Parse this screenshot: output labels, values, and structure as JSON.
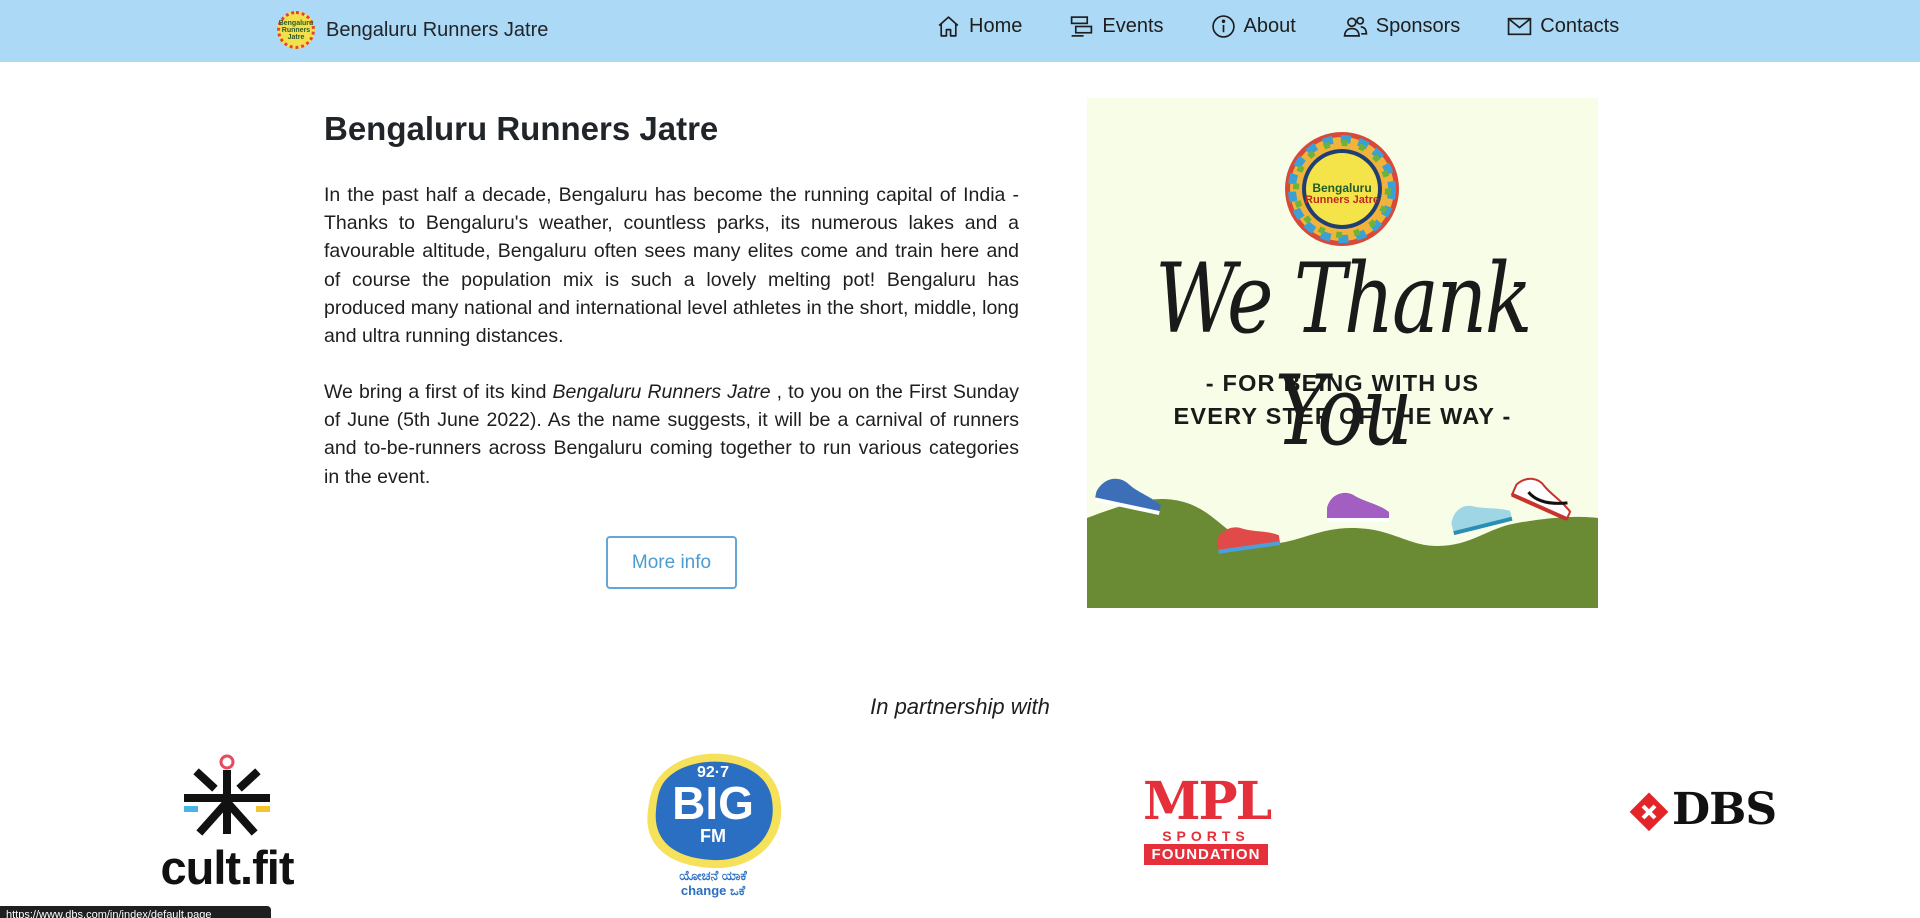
{
  "navbar": {
    "brand": "Bengaluru Runners Jatre",
    "brand_logo_lines": [
      "Bengaluru",
      "Runners Jatre"
    ],
    "links": [
      {
        "label": "Home",
        "icon": "home-icon"
      },
      {
        "label": "Events",
        "icon": "events-icon"
      },
      {
        "label": "About",
        "icon": "info-icon"
      },
      {
        "label": "Sponsors",
        "icon": "people-icon"
      },
      {
        "label": "Contacts",
        "icon": "envelope-icon"
      }
    ]
  },
  "main": {
    "title": "Bengaluru Runners Jatre",
    "paragraph1": "In the past half a decade, Bengaluru has become the running capital of India - Thanks to Bengaluru's weather, countless parks, its numerous lakes and a favourable altitude, Bengaluru often sees many elites come and train here and of course the population mix is such a lovely melting pot! Bengaluru has produced many national and international level athletes in the short, middle, long and ultra running distances.",
    "paragraph2_before": "We bring a first of its kind ",
    "paragraph2_emphasis": "Bengaluru Runners Jatre",
    "paragraph2_after": " , to you on the First Sunday of June (5th June 2022). As the name suggests, it will be a carnival of runners and to-be-runners across Bengaluru coming together to run various categories in the event.",
    "more_button": "More info"
  },
  "poster": {
    "logo_line1": "Bengaluru",
    "logo_line2": "Runners Jatre",
    "headline": "We Thank You",
    "line1": "- FOR BEING WITH US",
    "line2": "EVERY STEP OF THE WAY -",
    "colors": {
      "background": "#f8fde8",
      "hill": "#6a8a33"
    }
  },
  "partners": {
    "title": "In partnership with",
    "logos": [
      {
        "name": "cult.fit",
        "text": "cult.fit"
      },
      {
        "name": "92.7 BIG FM",
        "text_top": "92·7",
        "text_main": "BIG",
        "text_sub": "FM",
        "tagline_local": "ಯೋಚನೆ ಯಾಕೆ",
        "tagline": "change ಒಕೆ"
      },
      {
        "name": "MPL Sports Foundation",
        "text_main": "MPL",
        "text_sub": "SPORTS",
        "text_band": "FOUNDATION"
      },
      {
        "name": "DBS",
        "text": "DBS"
      }
    ]
  },
  "status_bar": {
    "url": "https://www.dbs.com/in/index/default.page"
  }
}
